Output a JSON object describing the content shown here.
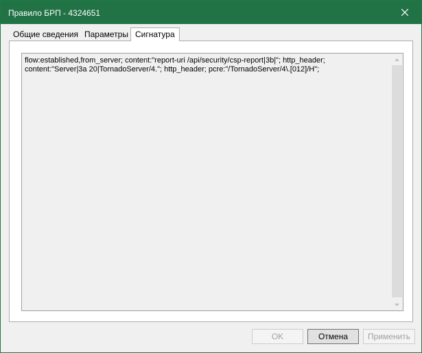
{
  "window": {
    "title": "Правило БРП - 4324651",
    "accent_color": "#217346"
  },
  "tabs": [
    {
      "label": "Общие сведения",
      "active": false
    },
    {
      "label": "Параметры",
      "active": false
    },
    {
      "label": "Сигнатура",
      "active": true
    }
  ],
  "signature": {
    "text": "flow:established,from_server; content:\"report-uri /api/security/csp-report|3b|\"; http_header;\ncontent:\"Server|3a 20|TornadoServer/4.\"; http_header; pcre:\"/TornadoServer/4\\.[012]/H\";"
  },
  "buttons": {
    "ok": {
      "label": "OK",
      "enabled": false
    },
    "cancel": {
      "label": "Отмена",
      "enabled": true
    },
    "apply": {
      "label": "Применить",
      "enabled": false
    }
  },
  "icons": {
    "close": "close-icon",
    "scroll_up": "arrow-up-icon",
    "scroll_down": "arrow-down-icon"
  }
}
